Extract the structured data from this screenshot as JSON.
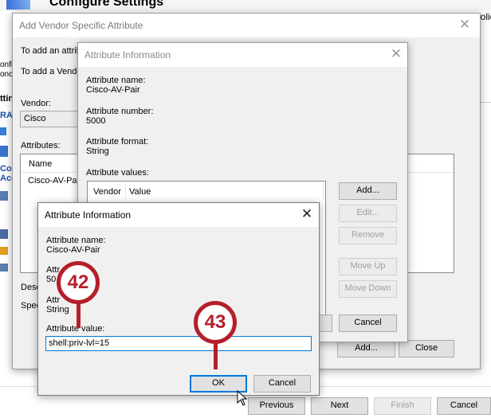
{
  "background": {
    "title": "Configure Settings",
    "right_fragment": "polic",
    "left_fragments": [
      "onfigu",
      "onco",
      "ttin",
      "RAD",
      "Cou",
      "Acce"
    ]
  },
  "vsa_dialog": {
    "title": "Add Vendor Specific Attribute",
    "line1": "To add an attrib",
    "line2": "To add a Vendo",
    "vendor_label": "Vendor:",
    "vendor_value": "Cisco",
    "attributes_label": "Attributes:",
    "col_name": "Name",
    "row_name": "Cisco-AV-Pair",
    "desc_label": "Desc",
    "spec_label": "Spec",
    "add_label": "Add...",
    "close_label": "Close"
  },
  "attr_info_back": {
    "title": "Attribute Information",
    "name_label": "Attribute name:",
    "name_value": "Cisco-AV-Pair",
    "number_label": "Attribute number:",
    "number_value": "5000",
    "format_label": "Attribute format:",
    "format_value": "String",
    "values_label": "Attribute values:",
    "col_vendor": "Vendor",
    "col_value": "Value",
    "add_label": "Add...",
    "edit_label": "Edit...",
    "remove_label": "Remove",
    "moveup_label": "Move Up",
    "movedown_label": "Move Down",
    "cancel_label": "Cancel"
  },
  "attr_info_front": {
    "title": "Attribute Information",
    "name_label": "Attribute name:",
    "name_value": "Cisco-AV-Pair",
    "number_label_partial": "Attr    ber:",
    "number_value_partial": "50",
    "format_label_partial": "Attr     at:",
    "format_value": "String",
    "value_label": "Attribute value:",
    "value_input": "shell:priv-lvl=15",
    "ok_label": "OK",
    "cancel_label": "Cancel"
  },
  "wizard_buttons": {
    "previous": "Previous",
    "next": "Next",
    "finish": "Finish",
    "cancel": "Cancel"
  },
  "callouts": {
    "a": "42",
    "b": "43",
    "color": "#b51f2a"
  }
}
